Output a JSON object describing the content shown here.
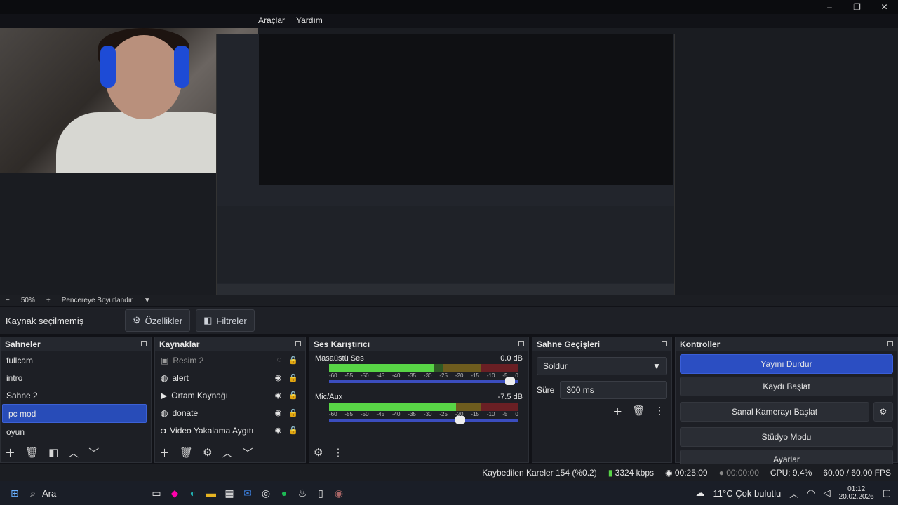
{
  "menu": [
    "Araçlar",
    "Yardım"
  ],
  "window_controls": [
    "–",
    "❐",
    "✕"
  ],
  "zoom": {
    "minus": "−",
    "value": "50%",
    "plus": "+",
    "fit": "Pencereye Boyutlandır",
    "caret": "▼"
  },
  "source_bar": {
    "label": "Kaynak seçilmemiş",
    "properties": "Özellikler",
    "filters": "Filtreler"
  },
  "scenes": {
    "title": "Sahneler",
    "items": [
      "fullcam",
      "intro",
      "Sahne 2",
      "pc mod",
      "oyun"
    ],
    "selected": 3
  },
  "sources": {
    "title": "Kaynaklar",
    "items": [
      {
        "icon": "image-icon",
        "label": "Resim 2",
        "visible": false
      },
      {
        "icon": "globe-icon",
        "label": "alert",
        "visible": true
      },
      {
        "icon": "play-icon",
        "label": "Ortam Kaynağı",
        "visible": true
      },
      {
        "icon": "globe-icon",
        "label": "donate",
        "visible": true
      },
      {
        "icon": "camera-icon",
        "label": "Video Yakalama Aygıtı",
        "visible": true
      }
    ]
  },
  "mixer": {
    "title": "Ses Karıştırıcı",
    "channels": [
      {
        "name": "Masaüstü Ses",
        "db": "0.0 dB",
        "level": 0.55,
        "volume": 0.98
      },
      {
        "name": "Mic/Aux",
        "db": "-7.5 dB",
        "level": 0.67,
        "volume": 0.72
      }
    ],
    "scale": [
      "-60",
      "-55",
      "-50",
      "-45",
      "-40",
      "-35",
      "-30",
      "-25",
      "-20",
      "-15",
      "-10",
      "-5",
      "0"
    ]
  },
  "transitions": {
    "title": "Sahne Geçişleri",
    "selected": "Soldur",
    "duration_label": "Süre",
    "duration": "300 ms"
  },
  "controls": {
    "title": "Kontroller",
    "buttons": [
      "Yayını Durdur",
      "Kaydı Başlat",
      "Sanal Kamerayı Başlat",
      "Stüdyo Modu",
      "Ayarlar"
    ]
  },
  "status": {
    "dropped": "Kaybedilen Kareler 154 (%0.2)",
    "bitrate": "3324 kbps",
    "stream_time": "00:25:09",
    "rec_time": "00:00:00",
    "cpu": "CPU: 9.4%",
    "fps": "60.00 / 60.00 FPS"
  },
  "taskbar": {
    "search": "Ara",
    "weather": "11°C  Çok bulutlu",
    "time": "01:12",
    "date": "20.02.2026"
  },
  "colors": {
    "accent": "#284cb8",
    "primary_button": "#2b4ec2",
    "meter_green": "#58d546"
  }
}
